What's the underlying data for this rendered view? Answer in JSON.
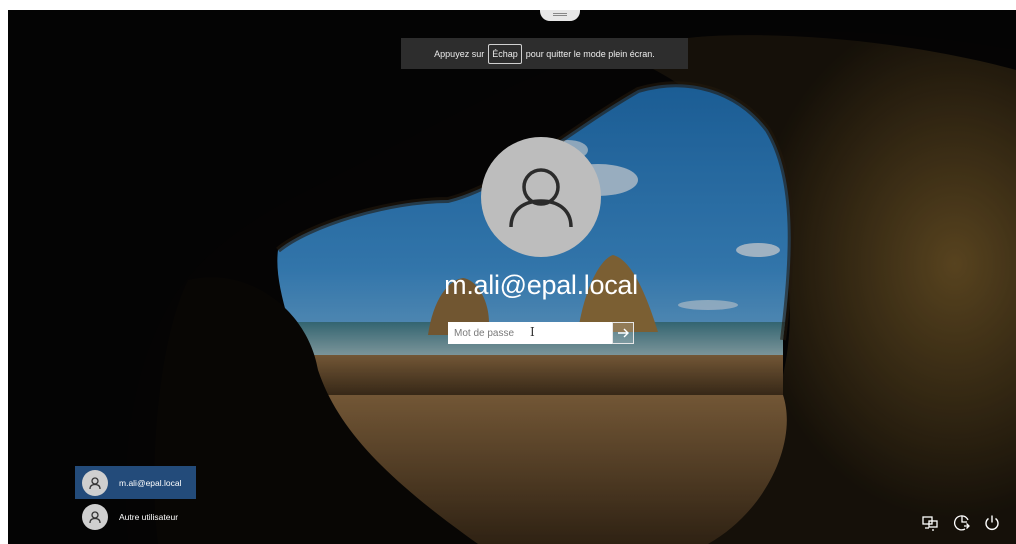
{
  "fullscreen_notice": {
    "prefix": "Appuyez sur",
    "key": "Échap",
    "suffix": "pour quitter le mode plein écran."
  },
  "login": {
    "username": "m.ali@epal.local",
    "password_placeholder": "Mot de passe"
  },
  "users": [
    {
      "label": "m.ali@epal.local",
      "selected": true
    },
    {
      "label": "Autre utilisateur",
      "selected": false
    }
  ],
  "system_icons": [
    "network-icon",
    "ease-of-access-icon",
    "power-icon"
  ],
  "colors": {
    "selected_user_bg": "#234b7a",
    "banner_bg": "#2d2d2d",
    "avatar_bg": "#bdbdbd"
  }
}
